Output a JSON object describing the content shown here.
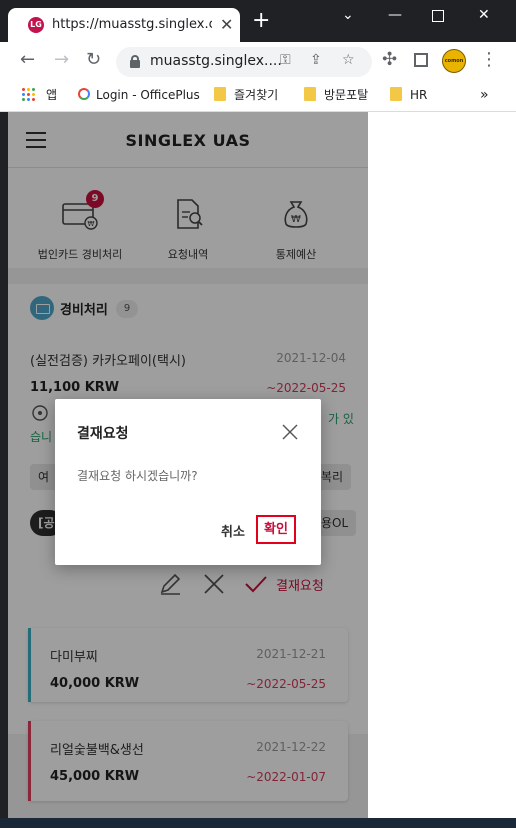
{
  "browser": {
    "tab_title": "https://muasstg.singlex.com/",
    "url": "muasstg.singlex....",
    "bookmarks": [
      {
        "label": "앱"
      },
      {
        "label": "Login - OfficePlus"
      },
      {
        "label": "즐겨찾기"
      },
      {
        "label": "방문포탈"
      },
      {
        "label": "HR"
      }
    ],
    "more_label": "»",
    "profile_label": "comon"
  },
  "app": {
    "title": "SINGLEX UAS",
    "quick_menu": [
      {
        "label": "법인카드 경비처리",
        "badge": "9",
        "icon": "card-icon"
      },
      {
        "label": "요청내역",
        "icon": "document-search-icon"
      },
      {
        "label": "통제예산",
        "icon": "money-bag-icon"
      }
    ],
    "section": {
      "title": "경비처리",
      "count": "9"
    },
    "detail": {
      "title": "(실전검증) 카카오페이(택시)",
      "date": "2021-12-04",
      "amount": "11,100 KRW",
      "due": "~2022-05-25",
      "message_right": "가 있",
      "message_line2": "습니",
      "chips": [
        "여",
        "복리",
        "[공",
        "용OL"
      ]
    },
    "actions": {
      "approve_label": "결재요청"
    },
    "cards": [
      {
        "name": "다미부찌",
        "date": "2021-12-21",
        "amount": "40,000 KRW",
        "due": "~2022-05-25",
        "accent": "#3aafc0"
      },
      {
        "name": "리얼숯불백&생선",
        "date": "2021-12-22",
        "amount": "45,000 KRW",
        "due": "~2022-01-07",
        "accent": "#e0405f"
      }
    ]
  },
  "dialog": {
    "title": "결재요청",
    "message": "결재요청 하시겠습니까?",
    "cancel": "취소",
    "confirm": "확인"
  },
  "colors": {
    "accent": "#c8103e",
    "highlight_border": "#e2001a"
  }
}
